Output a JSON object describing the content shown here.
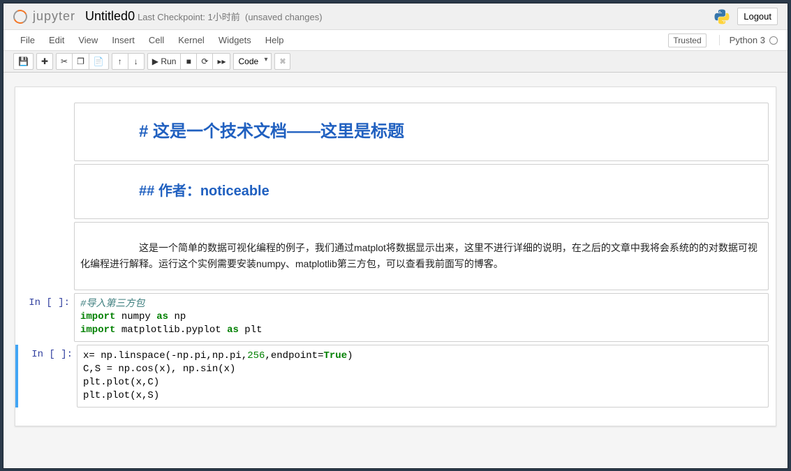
{
  "header": {
    "logo_text": "jupyter",
    "title": "Untitled0",
    "checkpoint": "Last Checkpoint: 1小时前",
    "autosave": "(unsaved changes)",
    "logout": "Logout"
  },
  "menus": [
    "File",
    "Edit",
    "View",
    "Insert",
    "Cell",
    "Kernel",
    "Widgets",
    "Help"
  ],
  "trust": {
    "trusted": "Trusted",
    "kernel": "Python 3"
  },
  "toolbar": {
    "save": "💾",
    "add": "✚",
    "cut": "✂",
    "copy": "❐",
    "paste": "📄",
    "up": "↑",
    "down": "↓",
    "run": "▶ Run",
    "stop": "■",
    "restart": "⟳",
    "restart_run": "▸▸",
    "celltype": "Code",
    "cmd": "⌘"
  },
  "cells": [
    {
      "type": "markdown",
      "h1": "# 这是一个技术文档——这里是标题"
    },
    {
      "type": "markdown",
      "h2": "## 作者：noticeable"
    },
    {
      "type": "markdown",
      "p": "这是一个简单的数据可视化编程的例子，我们通过matplot将数据显示出来，这里不进行详细的说明，在之后的文章中我将会系统的的对数据可视化编程进行解释。运行这个实例需要安装numpy、matplotlib第三方包，可以查看我前面写的博客。"
    },
    {
      "type": "code",
      "prompt": "In [ ]:",
      "lines": [
        {
          "seg": [
            {
              "t": "#导入第三方包",
              "cls": "c-cmt"
            }
          ]
        },
        {
          "seg": [
            {
              "t": "import",
              "cls": "c-kw"
            },
            {
              "t": " numpy "
            },
            {
              "t": "as",
              "cls": "c-kw"
            },
            {
              "t": " np"
            }
          ]
        },
        {
          "seg": [
            {
              "t": "import",
              "cls": "c-kw"
            },
            {
              "t": " matplotlib.pyplot "
            },
            {
              "t": "as",
              "cls": "c-kw"
            },
            {
              "t": " plt"
            }
          ]
        }
      ]
    },
    {
      "type": "code",
      "prompt": "In [ ]:",
      "selected": true,
      "lines": [
        {
          "seg": [
            {
              "t": "x= np.linspace(-np.pi,np.pi,"
            },
            {
              "t": "256",
              "cls": "c-num"
            },
            {
              "t": ",endpoint="
            },
            {
              "t": "True",
              "cls": "c-bool"
            },
            {
              "t": ")"
            }
          ]
        },
        {
          "seg": [
            {
              "t": "C,S = np.cos(x), np.sin(x)"
            }
          ]
        },
        {
          "seg": [
            {
              "t": "plt.plot(x,C)"
            }
          ]
        },
        {
          "seg": [
            {
              "t": "plt.plot(x,S)"
            }
          ]
        }
      ]
    }
  ]
}
